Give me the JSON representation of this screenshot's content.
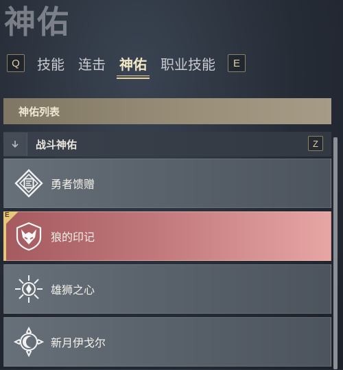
{
  "page": {
    "title": "神佑"
  },
  "tabs": {
    "prev_key": "Q",
    "next_key": "E",
    "items": [
      {
        "label": "技能",
        "active": false
      },
      {
        "label": "连击",
        "active": false
      },
      {
        "label": "神佑",
        "active": true
      },
      {
        "label": "职业技能",
        "active": false
      }
    ]
  },
  "list": {
    "header": "神佑列表",
    "group": {
      "label": "战斗神佑",
      "key": "Z"
    },
    "selected_corner": "E",
    "items": [
      {
        "label": "勇者馈赠",
        "icon": "hero-gift-icon",
        "selected": false
      },
      {
        "label": "狼的印记",
        "icon": "wolf-mark-icon",
        "selected": true
      },
      {
        "label": "雄狮之心",
        "icon": "lion-heart-icon",
        "selected": false
      },
      {
        "label": "新月伊戈尔",
        "icon": "crescent-igor-icon",
        "selected": false
      }
    ]
  },
  "colors": {
    "accent_gold": "#e6c77a",
    "selected_item": "#c0777a",
    "item_bg": "#5a626b"
  }
}
